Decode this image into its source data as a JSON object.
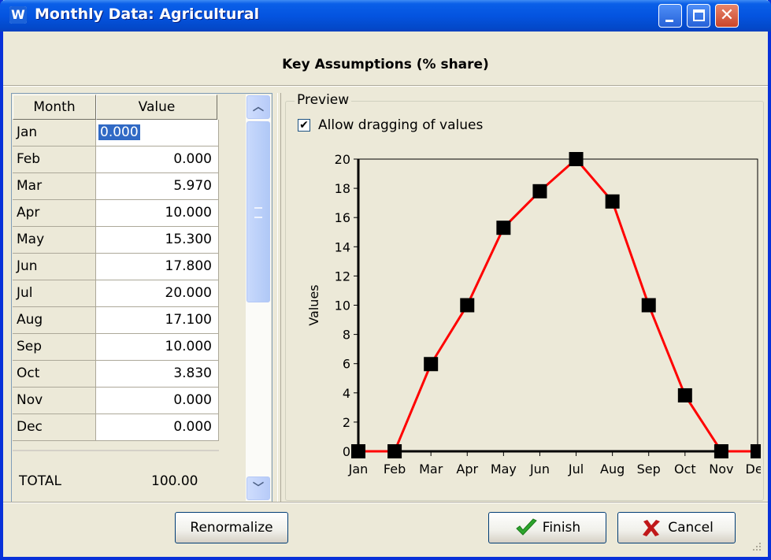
{
  "window": {
    "title": "Monthly Data: Agricultural",
    "app_icon_letter": "W",
    "titlebar_buttons": [
      "minimize",
      "maximize",
      "close"
    ]
  },
  "heading": "Key Assumptions (% share)",
  "grid": {
    "columns": [
      "Month",
      "Value"
    ],
    "rows": [
      {
        "month": "Jan",
        "value": "0.000"
      },
      {
        "month": "Feb",
        "value": "0.000"
      },
      {
        "month": "Mar",
        "value": "5.970"
      },
      {
        "month": "Apr",
        "value": "10.000"
      },
      {
        "month": "May",
        "value": "15.300"
      },
      {
        "month": "Jun",
        "value": "17.800"
      },
      {
        "month": "Jul",
        "value": "20.000"
      },
      {
        "month": "Aug",
        "value": "17.100"
      },
      {
        "month": "Sep",
        "value": "10.000"
      },
      {
        "month": "Oct",
        "value": "3.830"
      },
      {
        "month": "Nov",
        "value": "0.000"
      },
      {
        "month": "Dec",
        "value": "0.000"
      }
    ],
    "editing_row": 0,
    "total_label": "TOTAL",
    "total_value": "100.00"
  },
  "preview": {
    "group_label": "Preview",
    "allow_dragging_label": "Allow dragging of values",
    "allow_dragging_checked": true
  },
  "chart_data": {
    "type": "line",
    "categories": [
      "Jan",
      "Feb",
      "Mar",
      "Apr",
      "May",
      "Jun",
      "Jul",
      "Aug",
      "Sep",
      "Oct",
      "Nov",
      "Dec"
    ],
    "values": [
      0,
      0,
      5.97,
      10,
      15.3,
      17.8,
      20,
      17.1,
      10,
      3.83,
      0,
      0
    ],
    "ylabel": "Values",
    "ylim": [
      0,
      20
    ],
    "yticks": [
      0,
      2,
      4,
      6,
      8,
      10,
      12,
      14,
      16,
      18,
      20
    ],
    "line_color": "#FF0000",
    "marker_color": "#000000",
    "grid": false
  },
  "buttons": {
    "renormalize": "Renormalize",
    "finish": "Finish",
    "cancel": "Cancel"
  },
  "colors": {
    "titlebar": "#0454E0",
    "dialog_bg": "#ECE9D8",
    "selection": "#316AC5",
    "finish_icon": "#2DA52D",
    "cancel_icon": "#C0181A"
  }
}
